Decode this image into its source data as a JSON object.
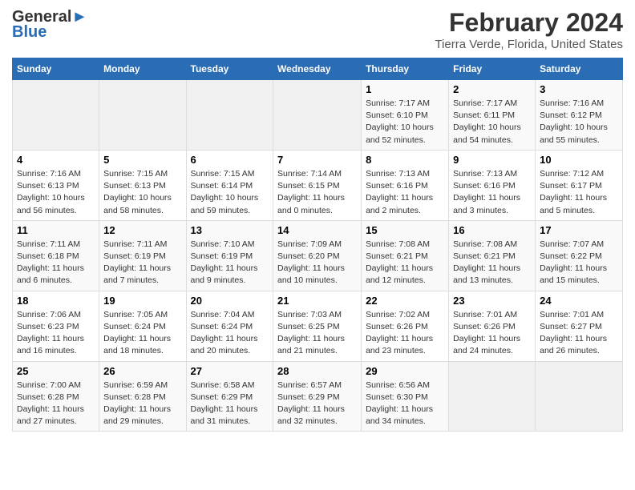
{
  "header": {
    "logo_general": "General",
    "logo_blue": "Blue",
    "month_title": "February 2024",
    "location": "Tierra Verde, Florida, United States"
  },
  "days_of_week": [
    "Sunday",
    "Monday",
    "Tuesday",
    "Wednesday",
    "Thursday",
    "Friday",
    "Saturday"
  ],
  "weeks": [
    [
      {
        "day": "",
        "info": ""
      },
      {
        "day": "",
        "info": ""
      },
      {
        "day": "",
        "info": ""
      },
      {
        "day": "",
        "info": ""
      },
      {
        "day": "1",
        "info": "Sunrise: 7:17 AM\nSunset: 6:10 PM\nDaylight: 10 hours\nand 52 minutes."
      },
      {
        "day": "2",
        "info": "Sunrise: 7:17 AM\nSunset: 6:11 PM\nDaylight: 10 hours\nand 54 minutes."
      },
      {
        "day": "3",
        "info": "Sunrise: 7:16 AM\nSunset: 6:12 PM\nDaylight: 10 hours\nand 55 minutes."
      }
    ],
    [
      {
        "day": "4",
        "info": "Sunrise: 7:16 AM\nSunset: 6:13 PM\nDaylight: 10 hours\nand 56 minutes."
      },
      {
        "day": "5",
        "info": "Sunrise: 7:15 AM\nSunset: 6:13 PM\nDaylight: 10 hours\nand 58 minutes."
      },
      {
        "day": "6",
        "info": "Sunrise: 7:15 AM\nSunset: 6:14 PM\nDaylight: 10 hours\nand 59 minutes."
      },
      {
        "day": "7",
        "info": "Sunrise: 7:14 AM\nSunset: 6:15 PM\nDaylight: 11 hours\nand 0 minutes."
      },
      {
        "day": "8",
        "info": "Sunrise: 7:13 AM\nSunset: 6:16 PM\nDaylight: 11 hours\nand 2 minutes."
      },
      {
        "day": "9",
        "info": "Sunrise: 7:13 AM\nSunset: 6:16 PM\nDaylight: 11 hours\nand 3 minutes."
      },
      {
        "day": "10",
        "info": "Sunrise: 7:12 AM\nSunset: 6:17 PM\nDaylight: 11 hours\nand 5 minutes."
      }
    ],
    [
      {
        "day": "11",
        "info": "Sunrise: 7:11 AM\nSunset: 6:18 PM\nDaylight: 11 hours\nand 6 minutes."
      },
      {
        "day": "12",
        "info": "Sunrise: 7:11 AM\nSunset: 6:19 PM\nDaylight: 11 hours\nand 7 minutes."
      },
      {
        "day": "13",
        "info": "Sunrise: 7:10 AM\nSunset: 6:19 PM\nDaylight: 11 hours\nand 9 minutes."
      },
      {
        "day": "14",
        "info": "Sunrise: 7:09 AM\nSunset: 6:20 PM\nDaylight: 11 hours\nand 10 minutes."
      },
      {
        "day": "15",
        "info": "Sunrise: 7:08 AM\nSunset: 6:21 PM\nDaylight: 11 hours\nand 12 minutes."
      },
      {
        "day": "16",
        "info": "Sunrise: 7:08 AM\nSunset: 6:21 PM\nDaylight: 11 hours\nand 13 minutes."
      },
      {
        "day": "17",
        "info": "Sunrise: 7:07 AM\nSunset: 6:22 PM\nDaylight: 11 hours\nand 15 minutes."
      }
    ],
    [
      {
        "day": "18",
        "info": "Sunrise: 7:06 AM\nSunset: 6:23 PM\nDaylight: 11 hours\nand 16 minutes."
      },
      {
        "day": "19",
        "info": "Sunrise: 7:05 AM\nSunset: 6:24 PM\nDaylight: 11 hours\nand 18 minutes."
      },
      {
        "day": "20",
        "info": "Sunrise: 7:04 AM\nSunset: 6:24 PM\nDaylight: 11 hours\nand 20 minutes."
      },
      {
        "day": "21",
        "info": "Sunrise: 7:03 AM\nSunset: 6:25 PM\nDaylight: 11 hours\nand 21 minutes."
      },
      {
        "day": "22",
        "info": "Sunrise: 7:02 AM\nSunset: 6:26 PM\nDaylight: 11 hours\nand 23 minutes."
      },
      {
        "day": "23",
        "info": "Sunrise: 7:01 AM\nSunset: 6:26 PM\nDaylight: 11 hours\nand 24 minutes."
      },
      {
        "day": "24",
        "info": "Sunrise: 7:01 AM\nSunset: 6:27 PM\nDaylight: 11 hours\nand 26 minutes."
      }
    ],
    [
      {
        "day": "25",
        "info": "Sunrise: 7:00 AM\nSunset: 6:28 PM\nDaylight: 11 hours\nand 27 minutes."
      },
      {
        "day": "26",
        "info": "Sunrise: 6:59 AM\nSunset: 6:28 PM\nDaylight: 11 hours\nand 29 minutes."
      },
      {
        "day": "27",
        "info": "Sunrise: 6:58 AM\nSunset: 6:29 PM\nDaylight: 11 hours\nand 31 minutes."
      },
      {
        "day": "28",
        "info": "Sunrise: 6:57 AM\nSunset: 6:29 PM\nDaylight: 11 hours\nand 32 minutes."
      },
      {
        "day": "29",
        "info": "Sunrise: 6:56 AM\nSunset: 6:30 PM\nDaylight: 11 hours\nand 34 minutes."
      },
      {
        "day": "",
        "info": ""
      },
      {
        "day": "",
        "info": ""
      }
    ]
  ]
}
